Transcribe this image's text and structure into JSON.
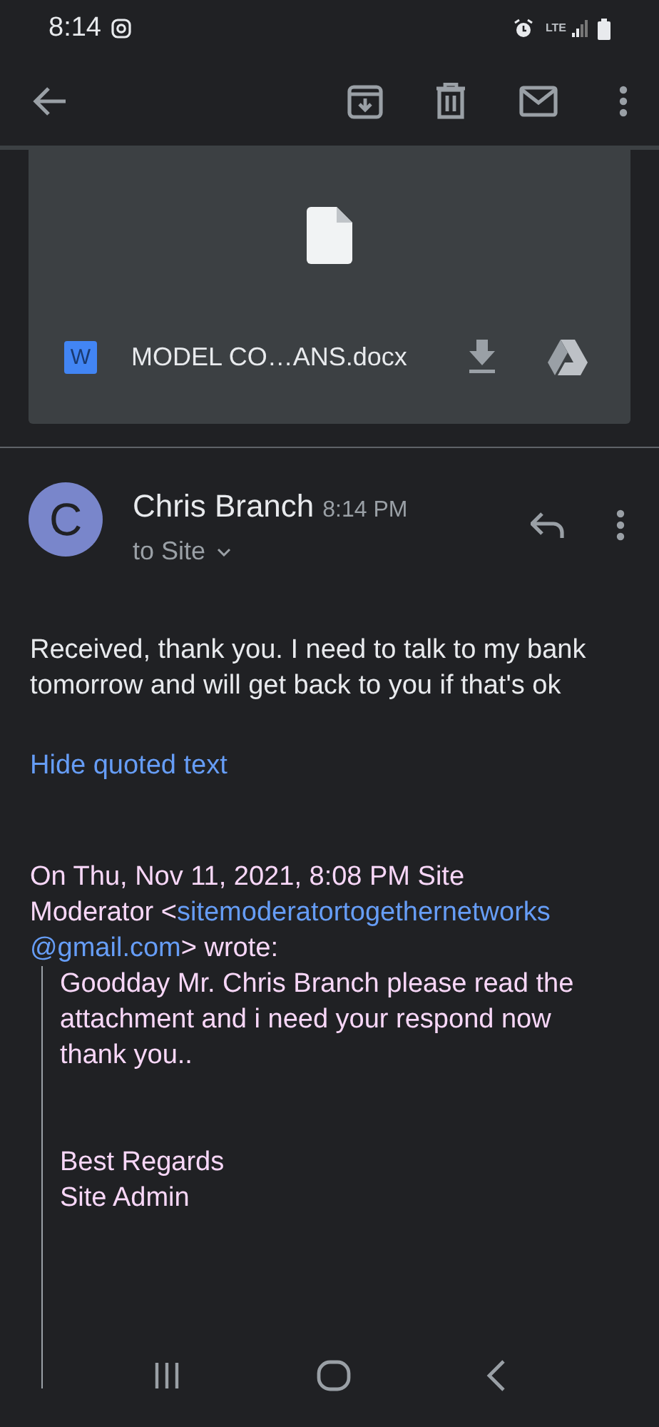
{
  "status_bar": {
    "time": "8:14",
    "network": "LTE"
  },
  "attachment": {
    "file_name": "MODEL CO…ANS.docx",
    "badge": "W"
  },
  "message": {
    "avatar_letter": "C",
    "sender": "Chris Branch",
    "time": "8:14 PM",
    "recipient": "to Site",
    "body": "Received, thank you. I need to talk to my bank tomorrow and will get back to you if that's ok",
    "quote_toggle": "Hide quoted text",
    "attribution_lines": [
      [
        {
          "text": "On Thu, Nov 11, 2021, 8:08 PM Site",
          "link": false
        }
      ],
      [
        {
          "text": "Moderator <",
          "link": false
        },
        {
          "text": "sitemoderatortogethernetworks",
          "link": true
        }
      ],
      [
        {
          "text": "@gmail.com",
          "link": true
        },
        {
          "text": "> wrote:",
          "link": false
        }
      ]
    ],
    "quoted_paragraphs": [
      "Goodday Mr. Chris Branch please read the attachment and i need your respond now thank you..",
      "Best Regards\nSite Admin"
    ]
  }
}
